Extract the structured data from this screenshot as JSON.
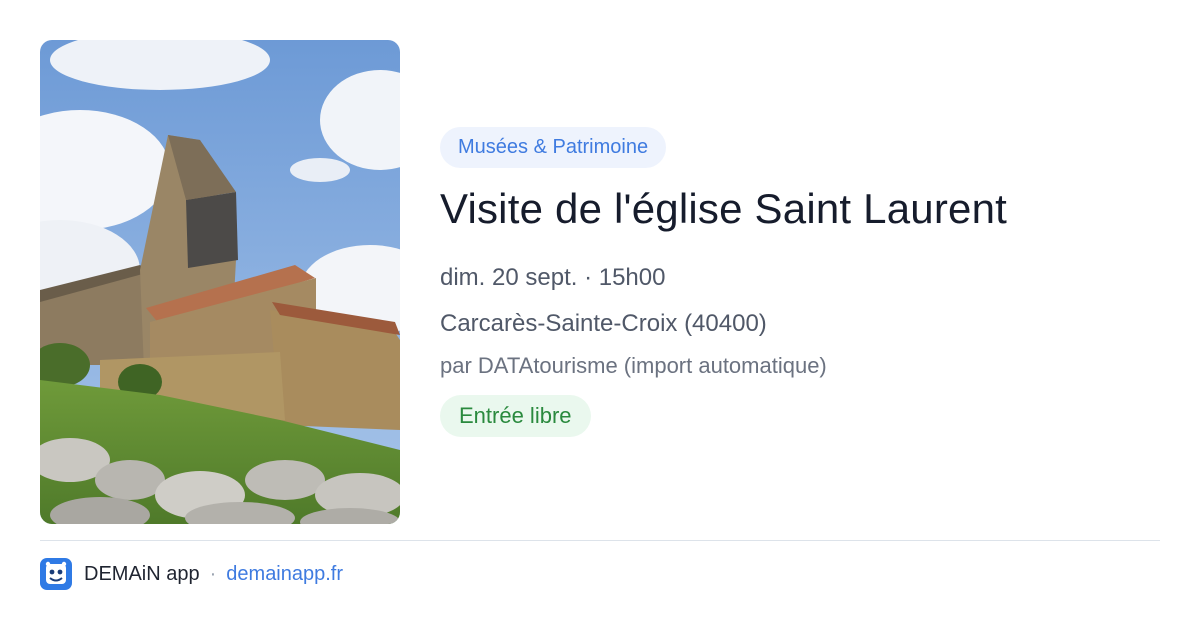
{
  "card": {
    "image_alt": "Église Saint Laurent",
    "category": "Musées & Patrimoine",
    "title": "Visite de l'église Saint Laurent",
    "datetime": "dim. 20 sept. · 15h00",
    "location": "Carcarès-Sainte-Croix (40400)",
    "organizer": "par DATAtourisme (import automatique)",
    "price": "Entrée libre"
  },
  "footer": {
    "app_name": "DEMAiN app",
    "separator": "·",
    "site": "demainapp.fr",
    "app_icon": "demain-logo-icon"
  },
  "colors": {
    "category_bg": "#eef3fd",
    "category_text": "#3f7be0",
    "price_bg": "#eaf8ee",
    "price_text": "#2a8a3e",
    "link": "#3f7be0",
    "title": "#161c2c"
  }
}
